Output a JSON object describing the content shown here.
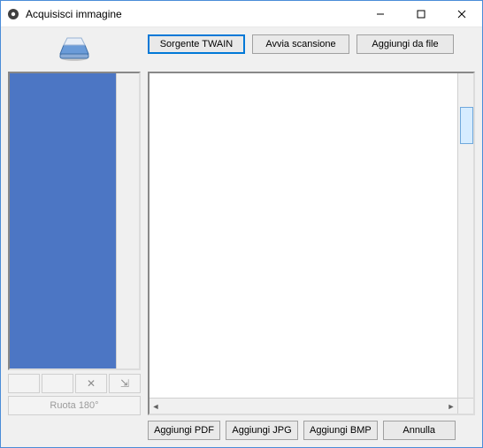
{
  "window": {
    "title": "Acquisisci immagine"
  },
  "toolbar_top": {
    "twain_source": "Sorgente TWAIN",
    "start_scan": "Avvia scansione",
    "add_from_file": "Aggiungi da file"
  },
  "left_toolbar": {
    "btn1": "",
    "btn2": "",
    "delete_label": "✕",
    "move_label": "⇲",
    "rotate_label": "Ruota 180°"
  },
  "bottom": {
    "add_pdf": "Aggiungi PDF",
    "add_jpg": "Aggiungi JPG",
    "add_bmp": "Aggiungi BMP",
    "cancel": "Annulla"
  },
  "hscroll": {
    "left_arrow": "◄",
    "right_arrow": "►"
  }
}
